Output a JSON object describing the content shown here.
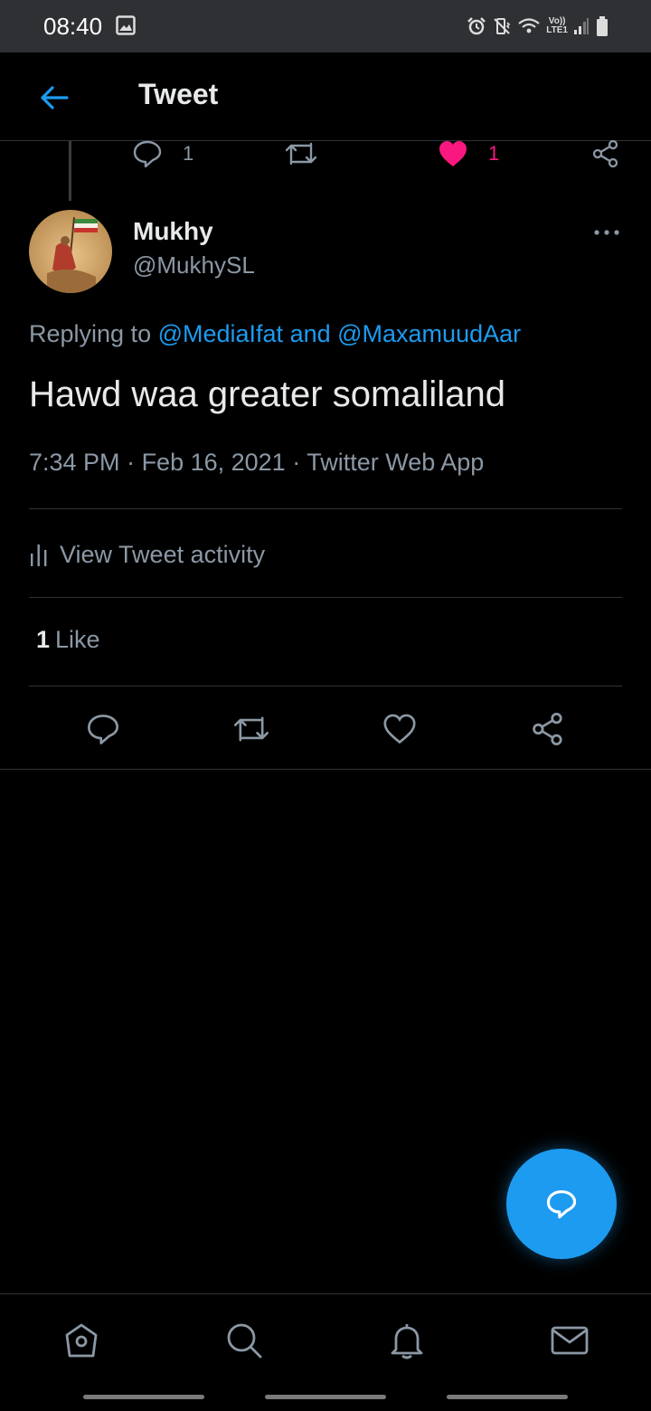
{
  "status_bar": {
    "time": "08:40",
    "network_label_top": "Vo))",
    "network_label_bottom": "LTE1"
  },
  "header": {
    "title": "Tweet"
  },
  "previous_tweet": {
    "reply_count": "1",
    "like_count": "1"
  },
  "tweet": {
    "author_name": "Mukhy",
    "author_handle": "@MukhySL",
    "replying_prefix": "Replying to ",
    "mention_1": "@MediaIfat",
    "mention_joiner": " and ",
    "mention_2": "@MaxamuudAar",
    "text": "Hawd waa greater somaliland",
    "time": "7:34 PM",
    "separator": " · ",
    "date": "Feb 16, 2021",
    "source": "Twitter Web App",
    "activity_label": "View Tweet activity",
    "likes_count": "1",
    "likes_label": "Like"
  },
  "colors": {
    "accent": "#1d9bf0",
    "like": "#f91880",
    "secondary_text": "#8b98a5"
  },
  "icons": [
    "back-arrow-icon",
    "reply-icon",
    "retweet-icon",
    "heart-icon",
    "share-icon",
    "more-icon",
    "activity-icon",
    "compose-icon",
    "home-icon",
    "search-icon",
    "bell-icon",
    "mail-icon"
  ]
}
